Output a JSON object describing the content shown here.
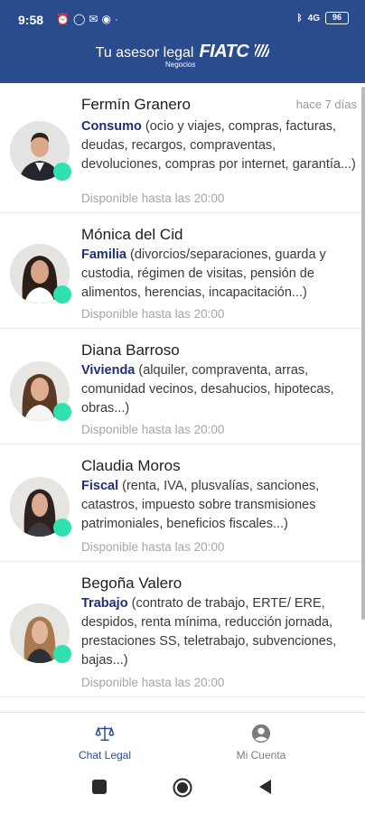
{
  "status_bar": {
    "time": "9:58",
    "left_icons": [
      "alarm-icon",
      "whatsapp-icon",
      "mail-icon",
      "spotify-icon",
      "dot-icon"
    ],
    "right_icons": [
      "bluetooth-icon",
      "signal-icon",
      "battery-icon"
    ],
    "signal_text": "4G",
    "battery_level": "96"
  },
  "header": {
    "title": "Tu asesor legal",
    "brand": "FIATC",
    "subtitle": "Negocios"
  },
  "advisors": [
    {
      "name": "Fermín Granero",
      "time_ago": "hace 7 días",
      "category": "Consumo",
      "details": "(ocio y viajes, compras, facturas, deudas, recargos, compraventas, devoluciones, compras por internet, garantía...)",
      "availability": "Disponible hasta las 20:00",
      "avatar_icon": "male-avatar-icon"
    },
    {
      "name": "Mónica del Cid",
      "time_ago": "",
      "category": "Familia",
      "details": "(divorcios/separaciones, guarda y custodia, régimen de visitas, pensión de alimentos, herencias, incapacitación...)",
      "availability": "Disponible hasta las 20:00",
      "avatar_icon": "female-avatar-icon"
    },
    {
      "name": "Diana Barroso",
      "time_ago": "",
      "category": "Vivienda",
      "details": "(alquiler, compraventa, arras, comunidad vecinos, desahucios, hipotecas, obras...)",
      "availability": "Disponible hasta las 20:00",
      "avatar_icon": "female-avatar-icon"
    },
    {
      "name": "Claudia Moros",
      "time_ago": "",
      "category": "Fiscal",
      "details": "(renta, IVA, plusvalías, sanciones, catastros, impuesto sobre transmisiones patrimoniales, beneficios fiscales...)",
      "availability": "Disponible hasta las 20:00",
      "avatar_icon": "female-avatar-icon"
    },
    {
      "name": "Begoña Valero",
      "time_ago": "",
      "category": "Trabajo",
      "details": "(contrato de trabajo, ERTE/ ERE, despidos, renta mínima, reducción jornada, prestaciones SS, teletrabajo, subvenciones, bajas...)",
      "availability": "Disponible hasta las 20:00",
      "avatar_icon": "female-avatar-icon"
    }
  ],
  "bottom_nav": {
    "items": [
      {
        "label": "Chat Legal",
        "icon": "scales-icon",
        "active": true
      },
      {
        "label": "Mi Cuenta",
        "icon": "account-icon",
        "active": false
      }
    ]
  },
  "colors": {
    "header_bg": "#2a4c8f",
    "online": "#2fe0b0",
    "category": "#1f2f7a"
  }
}
